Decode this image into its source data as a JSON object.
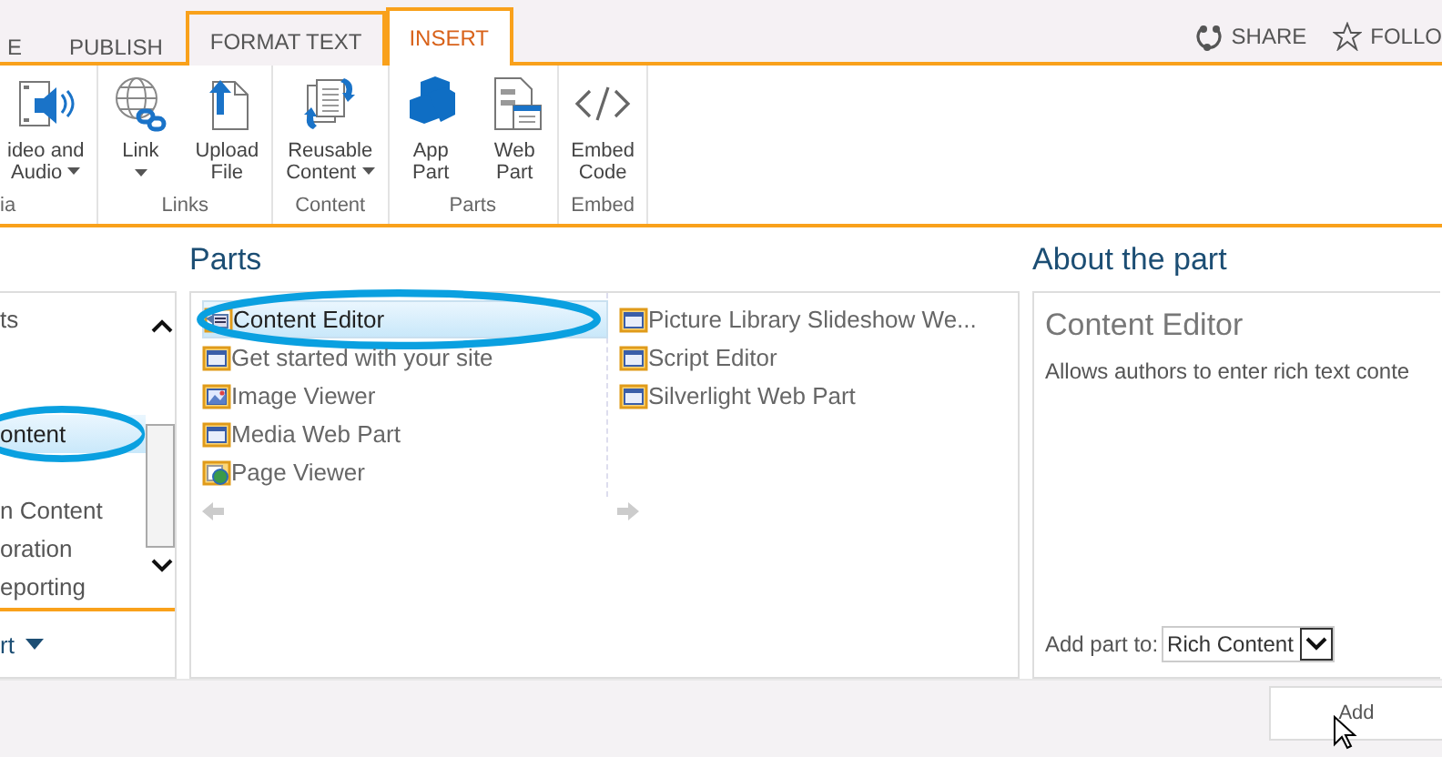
{
  "ribbon": {
    "tabs": [
      {
        "label": "E",
        "selected": false,
        "contextual": false
      },
      {
        "label": "PUBLISH",
        "selected": false,
        "contextual": false
      },
      {
        "label": "FORMAT TEXT",
        "selected": false,
        "contextual": true
      },
      {
        "label": "INSERT",
        "selected": true,
        "contextual": true
      }
    ],
    "actions": [
      {
        "label": "SHARE",
        "kind": "share"
      },
      {
        "label": "FOLLO",
        "kind": "follow"
      }
    ],
    "groups": [
      {
        "label": "ia",
        "buttons": [
          {
            "lines": [
              "ideo and",
              "Audio"
            ],
            "dropdown": true,
            "kind": "video"
          }
        ]
      },
      {
        "label": "Links",
        "buttons": [
          {
            "lines": [
              "Link"
            ],
            "dropdown": true,
            "kind": "link"
          },
          {
            "lines": [
              "Upload",
              "File"
            ],
            "dropdown": false,
            "kind": "upload"
          }
        ]
      },
      {
        "label": "Content",
        "buttons": [
          {
            "lines": [
              "Reusable",
              "Content"
            ],
            "dropdown": true,
            "kind": "reusable"
          }
        ]
      },
      {
        "label": "Parts",
        "buttons": [
          {
            "lines": [
              "App",
              "Part"
            ],
            "dropdown": false,
            "kind": "app"
          },
          {
            "lines": [
              "Web",
              "Part"
            ],
            "dropdown": false,
            "kind": "webpart"
          }
        ]
      },
      {
        "label": "Embed",
        "buttons": [
          {
            "lines": [
              "Embed",
              "Code"
            ],
            "dropdown": false,
            "kind": "embed"
          }
        ]
      }
    ]
  },
  "categories": {
    "items": [
      {
        "label": "ts",
        "selected": false,
        "circled": false
      },
      {
        "label": "ontent",
        "selected": true,
        "circled": true
      },
      {
        "label": "n Content",
        "selected": false,
        "circled": false
      },
      {
        "label": "oration",
        "selected": false,
        "circled": false
      },
      {
        "label": "eporting",
        "selected": false,
        "circled": false
      }
    ],
    "footer_link": "rt"
  },
  "parts": {
    "title": "Parts",
    "items": [
      {
        "label": "Content Editor",
        "kind": "editor",
        "selected": true,
        "circled": true
      },
      {
        "label": "Get started with your site",
        "kind": "page",
        "selected": false,
        "circled": false
      },
      {
        "label": "Image Viewer",
        "kind": "image",
        "selected": false,
        "circled": false
      },
      {
        "label": "Media Web Part",
        "kind": "page",
        "selected": false,
        "circled": false
      },
      {
        "label": "Page Viewer",
        "kind": "viewer",
        "selected": false,
        "circled": false
      },
      {
        "label": "Picture Library Slideshow We...",
        "kind": "page",
        "selected": false,
        "circled": false
      },
      {
        "label": "Script Editor",
        "kind": "page",
        "selected": false,
        "circled": false
      },
      {
        "label": "Silverlight Web Part",
        "kind": "page",
        "selected": false,
        "circled": false
      }
    ]
  },
  "about": {
    "title": "About the part",
    "part_name": "Content Editor",
    "description": "Allows authors to enter rich text conte",
    "add_to_label": "Add part to:",
    "add_to_value": "Rich Content"
  },
  "footer": {
    "add_button": "Add"
  }
}
